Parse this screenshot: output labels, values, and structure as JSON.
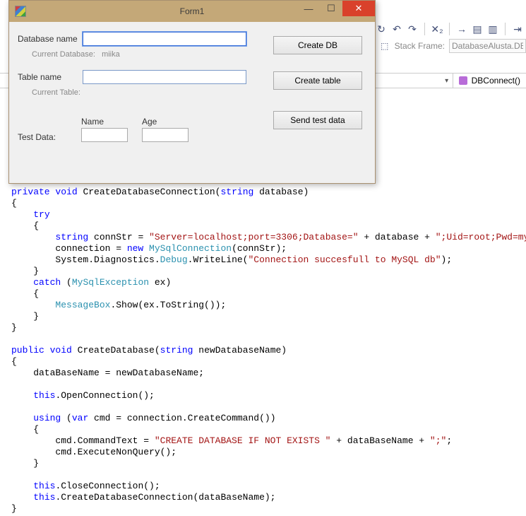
{
  "toolbar": {
    "icons": [
      "semicolon-icon",
      "refresh-icon",
      "step-back-icon",
      "step-forward-icon",
      "history-icon",
      "config-icon",
      "arrow-icon",
      "stack-icon",
      "outline-icon",
      "bookmark-icon"
    ],
    "stackframe_label": "Stack Frame:",
    "stackframe_value": "DatabaseAlusta.DBC"
  },
  "methodbar": {
    "method_icon": "cube-icon",
    "method_name": "DBConnect()"
  },
  "form1": {
    "title": "Form1",
    "labels": {
      "database_name": "Database name",
      "current_database": "Current Database:",
      "current_database_value": "miika",
      "table_name": "Table name",
      "current_table": "Current Table:",
      "test_data": "Test Data:",
      "name": "Name",
      "age": "Age"
    },
    "buttons": {
      "create_db": "Create DB",
      "create_table": "Create table",
      "send_test_data": "Send test data"
    },
    "inputs": {
      "database_name_value": "",
      "table_name_value": "",
      "name_value": "",
      "age_value": ""
    },
    "window_controls": {
      "minimize": "—",
      "maximize": "☐",
      "close": "✕"
    }
  },
  "code": {
    "lines": [
      {
        "indent": 0,
        "tokens": [
          {
            "t": "private",
            "c": "kw"
          },
          {
            "t": " "
          },
          {
            "t": "void",
            "c": "kw"
          },
          {
            "t": " CreateDatabaseConnection("
          },
          {
            "t": "string",
            "c": "kw"
          },
          {
            "t": " database)"
          }
        ]
      },
      {
        "indent": 0,
        "tokens": [
          {
            "t": "{"
          }
        ]
      },
      {
        "indent": 1,
        "tokens": [
          {
            "t": "try",
            "c": "kw"
          }
        ]
      },
      {
        "indent": 1,
        "tokens": [
          {
            "t": "{"
          }
        ]
      },
      {
        "indent": 2,
        "tokens": [
          {
            "t": "string",
            "c": "kw"
          },
          {
            "t": " connStr = "
          },
          {
            "t": "\"Server=localhost;port=3306;Database=\"",
            "c": "str"
          },
          {
            "t": " + database + "
          },
          {
            "t": "\";Uid=root;Pwd=mysli;\"",
            "c": "str"
          },
          {
            "t": ";"
          }
        ]
      },
      {
        "indent": 2,
        "tokens": [
          {
            "t": "connection = "
          },
          {
            "t": "new",
            "c": "kw"
          },
          {
            "t": " "
          },
          {
            "t": "MySqlConnection",
            "c": "type"
          },
          {
            "t": "(connStr);"
          }
        ]
      },
      {
        "indent": 2,
        "tokens": [
          {
            "t": "System.Diagnostics."
          },
          {
            "t": "Debug",
            "c": "type"
          },
          {
            "t": ".WriteLine("
          },
          {
            "t": "\"Connection succesfull to MySQL db\"",
            "c": "str"
          },
          {
            "t": ");"
          }
        ]
      },
      {
        "indent": 1,
        "tokens": [
          {
            "t": "}"
          }
        ]
      },
      {
        "indent": 1,
        "tokens": [
          {
            "t": "catch",
            "c": "kw"
          },
          {
            "t": " ("
          },
          {
            "t": "MySqlException",
            "c": "type"
          },
          {
            "t": " ex)"
          }
        ]
      },
      {
        "indent": 1,
        "tokens": [
          {
            "t": "{"
          }
        ]
      },
      {
        "indent": 2,
        "tokens": [
          {
            "t": "MessageBox",
            "c": "type"
          },
          {
            "t": ".Show(ex.ToString());"
          }
        ]
      },
      {
        "indent": 1,
        "tokens": [
          {
            "t": "}"
          }
        ]
      },
      {
        "indent": 0,
        "tokens": [
          {
            "t": "}"
          }
        ]
      },
      {
        "indent": 0,
        "tokens": []
      },
      {
        "indent": 0,
        "tokens": [
          {
            "t": "public",
            "c": "kw"
          },
          {
            "t": " "
          },
          {
            "t": "void",
            "c": "kw"
          },
          {
            "t": " CreateDatabase("
          },
          {
            "t": "string",
            "c": "kw"
          },
          {
            "t": " newDatabaseName)"
          }
        ]
      },
      {
        "indent": 0,
        "tokens": [
          {
            "t": "{"
          }
        ]
      },
      {
        "indent": 1,
        "tokens": [
          {
            "t": "dataBaseName = newDatabaseName;"
          }
        ]
      },
      {
        "indent": 0,
        "tokens": []
      },
      {
        "indent": 1,
        "tokens": [
          {
            "t": "this",
            "c": "kw"
          },
          {
            "t": ".OpenConnection();"
          }
        ]
      },
      {
        "indent": 0,
        "tokens": []
      },
      {
        "indent": 1,
        "tokens": [
          {
            "t": "using",
            "c": "kw"
          },
          {
            "t": " ("
          },
          {
            "t": "var",
            "c": "kw"
          },
          {
            "t": " cmd = connection.CreateCommand())"
          }
        ]
      },
      {
        "indent": 1,
        "tokens": [
          {
            "t": "{"
          }
        ]
      },
      {
        "indent": 2,
        "tokens": [
          {
            "t": "cmd.CommandText = "
          },
          {
            "t": "\"CREATE DATABASE IF NOT EXISTS \"",
            "c": "str"
          },
          {
            "t": " + dataBaseName + "
          },
          {
            "t": "\";\"",
            "c": "str"
          },
          {
            "t": ";"
          }
        ]
      },
      {
        "indent": 2,
        "tokens": [
          {
            "t": "cmd.ExecuteNonQuery();"
          }
        ]
      },
      {
        "indent": 1,
        "tokens": [
          {
            "t": "}"
          }
        ]
      },
      {
        "indent": 0,
        "tokens": []
      },
      {
        "indent": 1,
        "tokens": [
          {
            "t": "this",
            "c": "kw"
          },
          {
            "t": ".CloseConnection();"
          }
        ]
      },
      {
        "indent": 1,
        "tokens": [
          {
            "t": "this",
            "c": "kw"
          },
          {
            "t": ".CreateDatabaseConnection(dataBaseName);"
          }
        ]
      },
      {
        "indent": 0,
        "tokens": [
          {
            "t": "}"
          }
        ]
      }
    ]
  }
}
